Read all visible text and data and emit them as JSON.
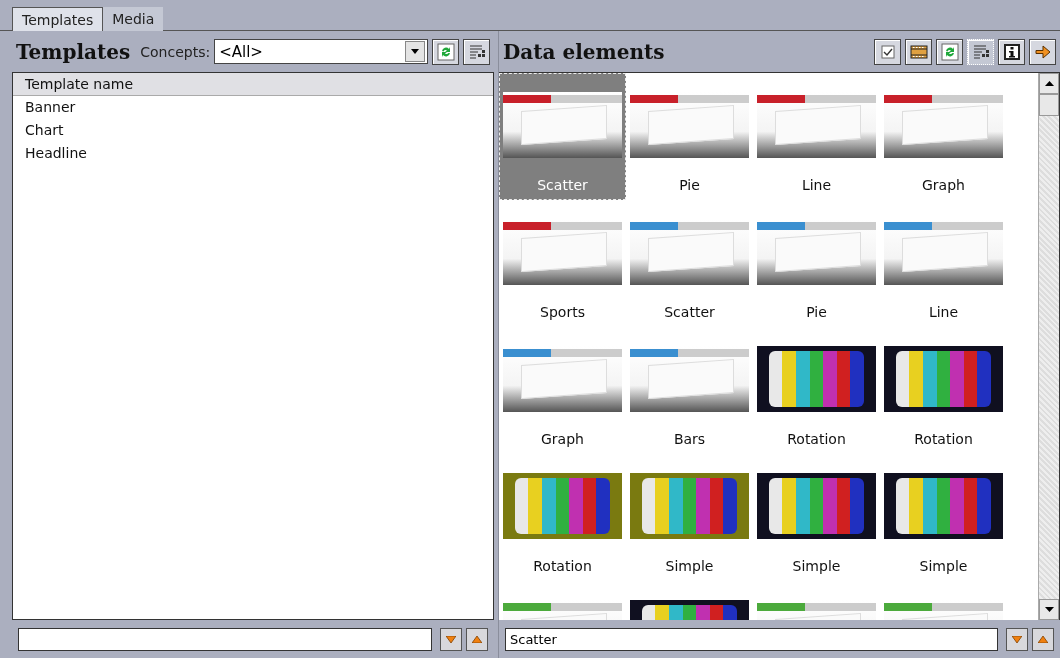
{
  "tabs": [
    {
      "label": "Templates",
      "selected": true
    },
    {
      "label": "Media",
      "selected": false
    }
  ],
  "templates_panel": {
    "title": "Templates",
    "concepts_label": "Concepts:",
    "concepts_value": "<All>",
    "column": "Template name",
    "items": [
      {
        "label": "Banner",
        "selected": false
      },
      {
        "label": "Chart",
        "selected": false
      },
      {
        "label": "Headline",
        "selected": false
      }
    ]
  },
  "data_panel": {
    "title": "Data elements",
    "filter_value": "Scatter",
    "tiles": [
      {
        "label": "Scatter",
        "kind": "chart",
        "color": "#c8202a",
        "selected": true
      },
      {
        "label": "Pie",
        "kind": "chart",
        "color": "#c8202a",
        "selected": false
      },
      {
        "label": "Line",
        "kind": "chart",
        "color": "#c8202a",
        "selected": false
      },
      {
        "label": "Graph",
        "kind": "chart",
        "color": "#c8202a",
        "selected": false
      },
      {
        "label": "Sports",
        "kind": "chart",
        "color": "#c8202a",
        "selected": false
      },
      {
        "label": "Scatter",
        "kind": "chart",
        "color": "#3a8fd0",
        "selected": false
      },
      {
        "label": "Pie",
        "kind": "chart",
        "color": "#3a8fd0",
        "selected": false
      },
      {
        "label": "Line",
        "kind": "chart",
        "color": "#3a8fd0",
        "selected": false
      },
      {
        "label": "Graph",
        "kind": "chart",
        "color": "#3a8fd0",
        "selected": false
      },
      {
        "label": "Bars",
        "kind": "chart",
        "color": "#3a8fd0",
        "selected": false
      },
      {
        "label": "Rotation",
        "kind": "video",
        "color": "#101020",
        "selected": false
      },
      {
        "label": "Rotation",
        "kind": "video",
        "color": "#101020",
        "selected": false
      },
      {
        "label": "Rotation",
        "kind": "video",
        "color": "#7a7a10",
        "selected": false
      },
      {
        "label": "Simple",
        "kind": "video",
        "color": "#7a7a10",
        "selected": false
      },
      {
        "label": "Simple",
        "kind": "video",
        "color": "#101020",
        "selected": false
      },
      {
        "label": "Simple",
        "kind": "video",
        "color": "#101020",
        "selected": false
      },
      {
        "kind": "chart",
        "color": "#4caa3c",
        "selected": false
      },
      {
        "kind": "video",
        "color": "#101020",
        "selected": false
      },
      {
        "kind": "chart",
        "color": "#4caa3c",
        "selected": false
      },
      {
        "kind": "chart",
        "color": "#4caa3c",
        "selected": false
      }
    ]
  }
}
